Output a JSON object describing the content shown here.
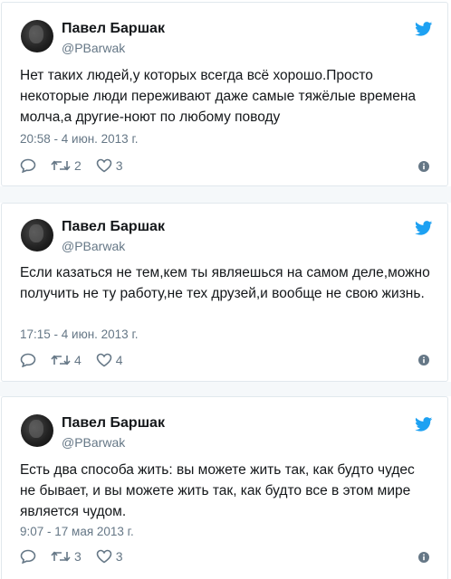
{
  "accent_color": "#1da1f2",
  "muted_color": "#657786",
  "tweets": [
    {
      "author_name": "Павел Баршак",
      "handle": "@PBarwak",
      "text": "Нет таких людей,у которых всегда всё хорошо.Просто некоторые люди переживают даже самые тяжёлые времена молча,а другие-ноют по любому поводу",
      "timestamp": "20:58 - 4 июн. 2013 г.",
      "retweets": "2",
      "likes": "3"
    },
    {
      "author_name": "Павел Баршак",
      "handle": "@PBarwak",
      "text": "Если казаться не тем,кем ты являешься на самом деле,можно получить не ту работу,не тех друзей,и вообще не свою жизнь.",
      "timestamp": "17:15 - 4 июн. 2013 г.",
      "retweets": "4",
      "likes": "4"
    },
    {
      "author_name": "Павел Баршак",
      "handle": "@PBarwak",
      "text": "Есть два способа жить: вы можете жить так, как будто чудес не бывает, и вы можете жить так, как будто все в этом мире является чудом.",
      "timestamp": "9:07 - 17 мая 2013 г.",
      "retweets": "3",
      "likes": "3"
    }
  ]
}
